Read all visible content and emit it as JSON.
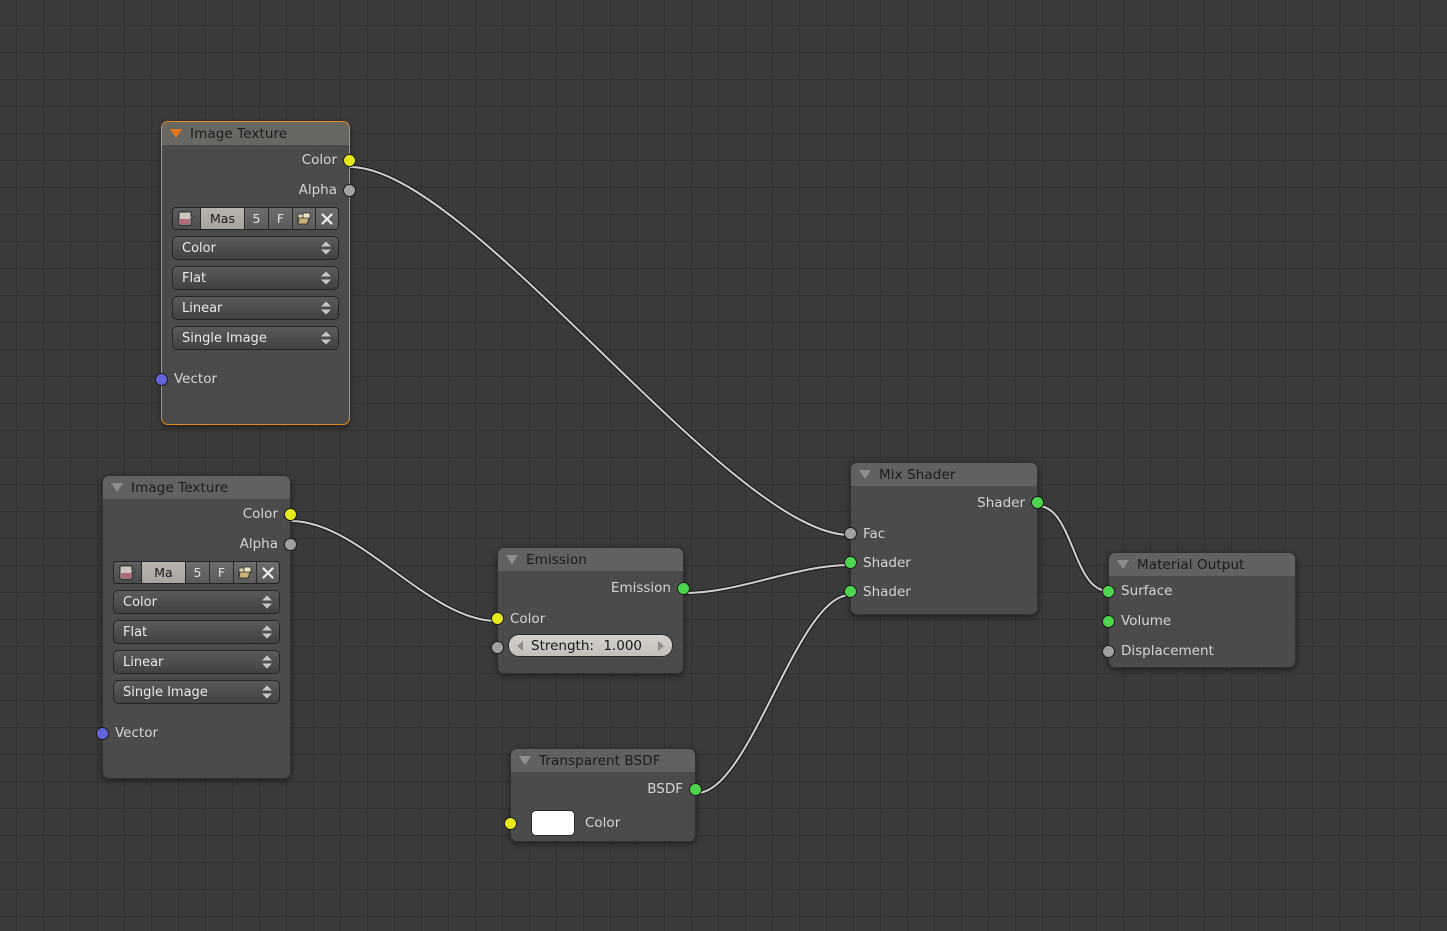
{
  "app": {
    "editor": "blender-shader-node-editor",
    "background_color": "#3a3a3a",
    "grid_color": "#323232",
    "wire_color": "#cfcfcf",
    "selected_outline_color": "#e08a20"
  },
  "socket_colors": {
    "color": "#e8e81e",
    "value": "#a1a1a1",
    "shader": "#4fd44f",
    "vector": "#6363d8"
  },
  "nodes": {
    "image_texture_top": {
      "title": "Image Texture",
      "selected": true,
      "outputs": [
        {
          "label": "Color",
          "type": "color"
        },
        {
          "label": "Alpha",
          "type": "value"
        }
      ],
      "image_block": {
        "icon": "image-datablock-icon",
        "name": "Mas",
        "users": "5",
        "fake_user": "F",
        "open_icon": "open-file-icon",
        "unlink_icon": "unlink-x-icon"
      },
      "dropdowns": [
        {
          "name": "color-space",
          "value": "Color"
        },
        {
          "name": "projection",
          "value": "Flat"
        },
        {
          "name": "interpolation",
          "value": "Linear"
        },
        {
          "name": "source",
          "value": "Single Image"
        }
      ],
      "inputs": [
        {
          "label": "Vector",
          "type": "vector"
        }
      ]
    },
    "image_texture_bottom": {
      "title": "Image Texture",
      "selected": false,
      "outputs": [
        {
          "label": "Color",
          "type": "color"
        },
        {
          "label": "Alpha",
          "type": "value"
        }
      ],
      "image_block": {
        "icon": "image-datablock-icon",
        "name": "Ma",
        "users": "5",
        "fake_user": "F",
        "open_icon": "open-file-icon",
        "unlink_icon": "unlink-x-icon"
      },
      "dropdowns": [
        {
          "name": "color-space",
          "value": "Color"
        },
        {
          "name": "projection",
          "value": "Flat"
        },
        {
          "name": "interpolation",
          "value": "Linear"
        },
        {
          "name": "source",
          "value": "Single Image"
        }
      ],
      "inputs": [
        {
          "label": "Vector",
          "type": "vector"
        }
      ]
    },
    "emission": {
      "title": "Emission",
      "selected": false,
      "outputs": [
        {
          "label": "Emission",
          "type": "shader"
        }
      ],
      "inputs": [
        {
          "label": "Color",
          "type": "color"
        },
        {
          "label": "Strength",
          "type": "value"
        }
      ],
      "strength": {
        "label": "Strength:",
        "value": "1.000"
      }
    },
    "transparent_bsdf": {
      "title": "Transparent BSDF",
      "selected": false,
      "outputs": [
        {
          "label": "BSDF",
          "type": "shader"
        }
      ],
      "inputs": [
        {
          "label": "Color",
          "type": "color",
          "swatch_color": "#ffffff"
        }
      ]
    },
    "mix_shader": {
      "title": "Mix Shader",
      "selected": false,
      "outputs": [
        {
          "label": "Shader",
          "type": "shader"
        }
      ],
      "inputs": [
        {
          "label": "Fac",
          "type": "value"
        },
        {
          "label": "Shader",
          "type": "shader"
        },
        {
          "label": "Shader",
          "type": "shader"
        }
      ]
    },
    "material_output": {
      "title": "Material Output",
      "selected": false,
      "inputs": [
        {
          "label": "Surface",
          "type": "shader"
        },
        {
          "label": "Volume",
          "type": "shader"
        },
        {
          "label": "Displacement",
          "type": "value"
        }
      ]
    }
  },
  "links": [
    {
      "from": "image_texture_top.Color",
      "to": "mix_shader.Fac"
    },
    {
      "from": "image_texture_bottom.Color",
      "to": "emission.Color"
    },
    {
      "from": "emission.Emission",
      "to": "mix_shader.Shader1"
    },
    {
      "from": "transparent_bsdf.BSDF",
      "to": "mix_shader.Shader2"
    },
    {
      "from": "mix_shader.Shader",
      "to": "material_output.Surface"
    }
  ]
}
